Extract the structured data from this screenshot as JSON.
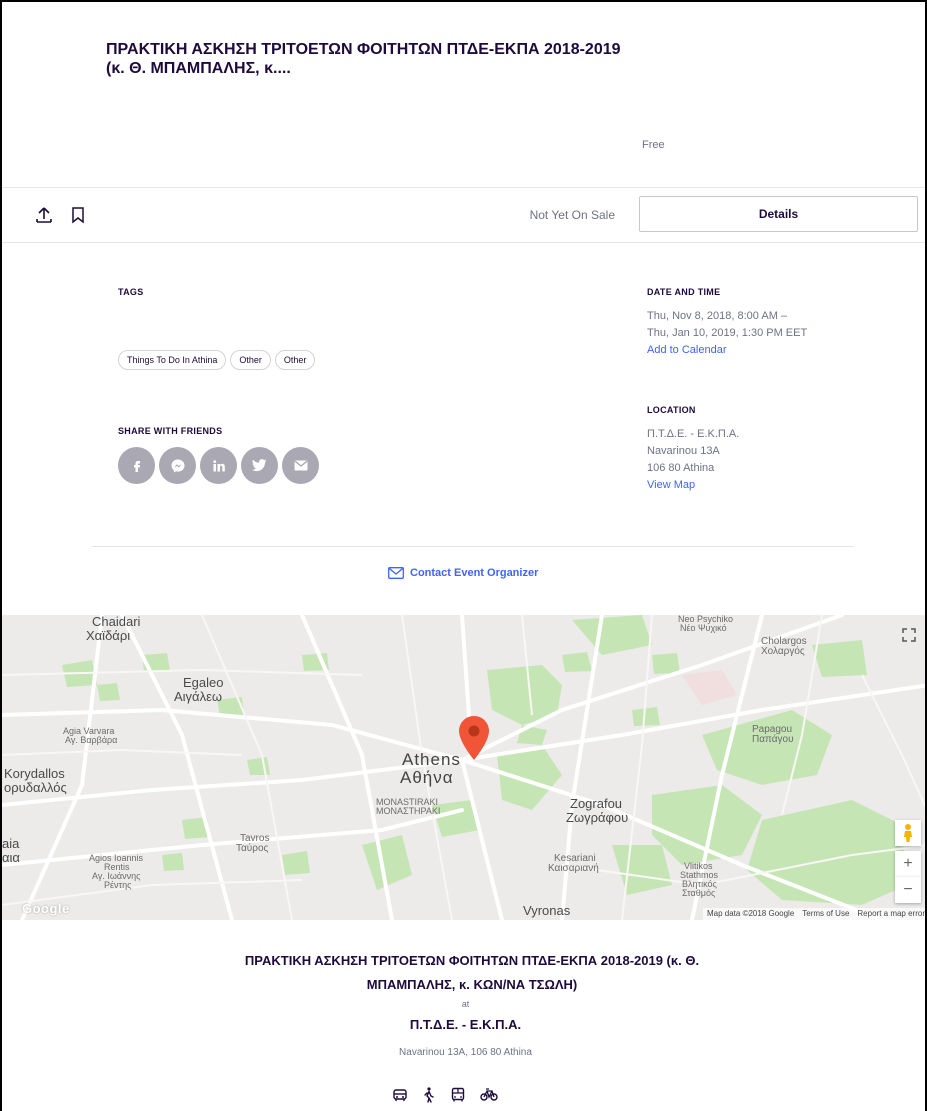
{
  "event": {
    "title": "ΠΡΑΚΤΙΚΗ ΑΣΚΗΣΗ ΤΡΙΤΟΕΤΩΝ ΦΟΙΤΗΤΩΝ ΠΤΔΕ-ΕΚΠΑ 2018-2019 (κ. Θ. ΜΠΑΜΠΑΛΗΣ, κ....",
    "price": "Free"
  },
  "actions": {
    "share_icon": "upload-icon",
    "save_icon": "bookmark-icon",
    "sale_status": "Not Yet On Sale",
    "details_label": "Details"
  },
  "tags": {
    "heading": "TAGS",
    "items": [
      "Things To Do In Athina",
      "Other",
      "Other"
    ]
  },
  "share": {
    "heading": "SHARE WITH FRIENDS",
    "networks": [
      "facebook-icon",
      "messenger-icon",
      "linkedin-icon",
      "twitter-icon",
      "email-icon"
    ],
    "color": "#a9a8b3"
  },
  "datetime": {
    "heading": "DATE AND TIME",
    "line1": "Thu, Nov 8, 2018, 8:00 AM –",
    "line2": "Thu, Jan 10, 2019, 1:30 PM EET",
    "calendar_link": "Add to Calendar"
  },
  "location": {
    "heading": "LOCATION",
    "venue": "Π.Τ.Δ.Ε. - Ε.Κ.Π.Α.",
    "street": "Navarinou 13A",
    "city": "106 80 Athina",
    "map_link": "View Map"
  },
  "contact": {
    "label": "Contact Event Organizer",
    "icon": "envelope-icon"
  },
  "map": {
    "labels": {
      "chaidari": "Chaidari",
      "chaidari_gr": "Χαϊδάρι",
      "egaleo": "Egaleo",
      "egaleo_gr": "Αιγάλεω",
      "agia_varvara": "Agia Varvara",
      "agia_varvara_gr": "Αγ. Βαρβάρα",
      "korydallos": "Korydallos",
      "korydallos_gr": "ορυδαλλός",
      "athens": "Athens",
      "athens_gr": "Αθήνα",
      "monastiraki": "MONASTIRAKI",
      "monastiraki_gr": "ΜΟΝΑΣΤΗΡΑΚΙ",
      "tavros": "Tavros",
      "tavros_gr": "Ταύρος",
      "agios_ioannis": "Agios Ioannis",
      "rentis": "Rentis",
      "agios_ioannis_gr": "Αγ. Ιωάννης",
      "rentis_gr": "Ρέντης",
      "aia": "aia",
      "aia_gr": "αια",
      "neo_psychiko": "Neo Psychiko",
      "neo_psychiko_gr": "Νέο Ψυχικό",
      "cholargos": "Cholargos",
      "cholargos_gr": "Χολαργός",
      "papagou": "Papagou",
      "papagou_gr": "Παπάγου",
      "zografou": "Zografou",
      "zografou_gr": "Ζωγράφου",
      "kesariani": "Kesariani",
      "kesariani_gr": "Καισαριανή",
      "vlitikos": "Vlitikos",
      "stathmos": "Stathmos",
      "vlitikos_gr": "Βλητικός",
      "stathmos_gr": "Σταθμός",
      "vyronas": "Vyronas"
    },
    "google_logo": "Google",
    "attribution": "Map data ©2018 Google",
    "terms": "Terms of Use",
    "report": "Report a map error",
    "zoom_in": "+",
    "zoom_out": "−",
    "pin_color": "#f05537"
  },
  "footer": {
    "title_line1": "ΠΡΑΚΤΙΚΗ ΑΣΚΗΣΗ ΤΡΙΤΟΕΤΩΝ ΦΟΙΤΗΤΩΝ ΠΤΔΕ-ΕΚΠΑ 2018-2019 (κ. Θ.",
    "title_line2": "ΜΠΑΜΠΑΛΗΣ, κ. ΚΩΝ/ΝΑ ΤΣΩΛΗ)",
    "at": "at",
    "venue": "Π.Τ.Δ.Ε. - Ε.Κ.Π.Α.",
    "address": "Navarinou 13A, 106 80 Athina",
    "transport_icons": [
      "car-icon",
      "walk-icon",
      "bus-icon",
      "bike-icon"
    ]
  },
  "colors": {
    "link": "#3d64ff",
    "text_dark": "#1e0a3c",
    "text_muted": "#6f7287",
    "map_green": "#c5e6b4",
    "map_bg": "#ecebea"
  }
}
